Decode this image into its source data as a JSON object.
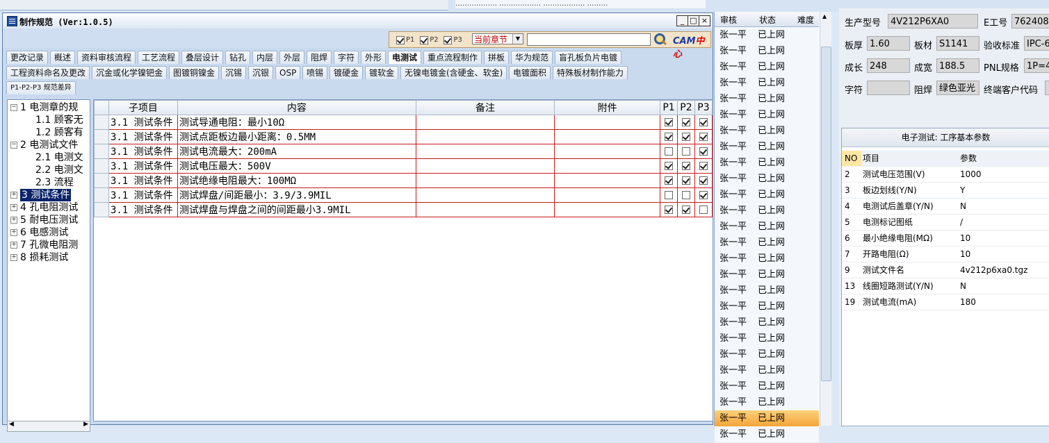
{
  "top_strip": {
    "partial_text": "……………… ……………… ……………… ………"
  },
  "window": {
    "title": "制作规范 (Ver:1.0.5)",
    "buttons": {
      "minimize": "_",
      "maximize": "□",
      "close": "×"
    }
  },
  "toolbar": {
    "p1": "P1",
    "p2": "P2",
    "p3": "P3",
    "chapter_select": "当前章节",
    "search_placeholder": "",
    "logo_main": "CAM",
    "logo_accent": "中心"
  },
  "tabs_row1": [
    "更改记录",
    "概述",
    "资料审核流程",
    "工艺流程",
    "叠层设计",
    "钻孔",
    "内层",
    "外层",
    "阻焊",
    "字符",
    "外形",
    "电测试",
    "重点流程制作",
    "拼板",
    "华为规范",
    "盲孔板负片电镀"
  ],
  "tabs_row2": [
    "工程资料命名及更改",
    "沉金或化学镍钯金",
    "图镀铜镍金",
    "沉锡",
    "沉银",
    "OSP",
    "喷锡",
    "镀硬金",
    "镀软金",
    "无镍电镀金(含硬金、软金)",
    "电镀面积",
    "特殊板材制作能力"
  ],
  "tabs_row3": [
    "P1-P2-P3 规范差异"
  ],
  "active_tab": "电测试",
  "tree": [
    {
      "label": "1 电测章的规",
      "level": 0,
      "exp": "−"
    },
    {
      "label": "1.1 顾客无",
      "level": 1
    },
    {
      "label": "1.2 顾客有",
      "level": 1
    },
    {
      "label": "2 电测试文件",
      "level": 0,
      "exp": "−"
    },
    {
      "label": "2.1 电测文",
      "level": 1
    },
    {
      "label": "2.2 电测文",
      "level": 1
    },
    {
      "label": "2.3 流程",
      "level": 1
    },
    {
      "label": "3 测试条件",
      "level": 0,
      "exp": "+",
      "selected": true
    },
    {
      "label": "4 孔电阻测试",
      "level": 0,
      "exp": "+"
    },
    {
      "label": "5 耐电压测试",
      "level": 0,
      "exp": "+"
    },
    {
      "label": "6 电感测试",
      "level": 0,
      "exp": "+"
    },
    {
      "label": "7 孔微电阻测",
      "level": 0,
      "exp": "+"
    },
    {
      "label": "8 损耗测试",
      "level": 0,
      "exp": "+"
    }
  ],
  "grid": {
    "headers": [
      "子项目",
      "内容",
      "备注",
      "附件",
      "P1",
      "P2",
      "P3"
    ],
    "rows": [
      {
        "sub": "3.1 测试条件",
        "content": "测试导通电阻：最小10Ω",
        "note": "",
        "att": "",
        "p1": true,
        "p2": true,
        "p3": true
      },
      {
        "sub": "3.1 测试条件",
        "content": "测试点距板边最小距离：0.5MM",
        "note": "",
        "att": "",
        "p1": true,
        "p2": true,
        "p3": true
      },
      {
        "sub": "3.1 测试条件",
        "content": "测试电流最大：200mA",
        "note": "",
        "att": "",
        "p1": false,
        "p2": false,
        "p3": true
      },
      {
        "sub": "3.1 测试条件",
        "content": "测试电压最大：500V",
        "note": "",
        "att": "",
        "p1": true,
        "p2": true,
        "p3": true
      },
      {
        "sub": "3.1 测试条件",
        "content": "测试绝缘电阻最大：100MΩ",
        "note": "",
        "att": "",
        "p1": true,
        "p2": true,
        "p3": true
      },
      {
        "sub": "3.1 测试条件",
        "content": "测试焊盘/间距最小：3.9/3.9MIL",
        "note": "",
        "att": "",
        "p1": false,
        "p2": false,
        "p3": true
      },
      {
        "sub": "3.1 测试条件",
        "content": "测试焊盘与焊盘之间的间距最小3.9MIL",
        "note": "",
        "att": "",
        "p1": true,
        "p2": true,
        "p3": false
      }
    ]
  },
  "review": {
    "headers": [
      "审核",
      "状态",
      "难度"
    ],
    "rows": [
      {
        "reviewer": "张一平",
        "status": "已上网"
      },
      {
        "reviewer": "张一平",
        "status": "已上网"
      },
      {
        "reviewer": "张一平",
        "status": "已上网"
      },
      {
        "reviewer": "张一平",
        "status": "已上网"
      },
      {
        "reviewer": "张一平",
        "status": "已上网"
      },
      {
        "reviewer": "张一平",
        "status": "已上网"
      },
      {
        "reviewer": "张一平",
        "status": "已上网"
      },
      {
        "reviewer": "张一平",
        "status": "已上网"
      },
      {
        "reviewer": "张一平",
        "status": "已上网"
      },
      {
        "reviewer": "张一平",
        "status": "已上网"
      },
      {
        "reviewer": "张一平",
        "status": "已上网"
      },
      {
        "reviewer": "张一平",
        "status": "已上网"
      },
      {
        "reviewer": "张一平",
        "status": "已上网"
      },
      {
        "reviewer": "张一平",
        "status": "已上网"
      },
      {
        "reviewer": "张一平",
        "status": "已上网"
      },
      {
        "reviewer": "张一平",
        "status": "已上网"
      },
      {
        "reviewer": "张一平",
        "status": "已上网"
      },
      {
        "reviewer": "张一平",
        "status": "已上网"
      },
      {
        "reviewer": "张一平",
        "status": "已上网"
      },
      {
        "reviewer": "张一平",
        "status": "已上网"
      },
      {
        "reviewer": "张一平",
        "status": "已上网"
      },
      {
        "reviewer": "张一平",
        "status": "已上网"
      },
      {
        "reviewer": "张一平",
        "status": "已上网"
      },
      {
        "reviewer": "张一平",
        "status": "已上网"
      },
      {
        "reviewer": "张一平",
        "status": "已上网"
      },
      {
        "reviewer": "张一平",
        "status": "已上网"
      }
    ],
    "highlight_color": "#f4a43a"
  },
  "info": {
    "model_label": "生产型号",
    "model": "4V212P6XA0",
    "e_label": "E工号",
    "e_no": "762408",
    "thick_label": "板厚",
    "thick": "1.60",
    "mat_label": "板材",
    "mat": "S1141",
    "std_label": "验收标准",
    "std": "IPC-6",
    "len_label": "成长",
    "len": "248",
    "wid_label": "成宽",
    "wid": "188.5",
    "pnl_label": "PNL规格",
    "pnl": "1P=4",
    "char_label": "字符",
    "char": "",
    "mask_label": "阻焊",
    "mask": "绿色亚光",
    "cust_label": "终端客户代码",
    "cust": ""
  },
  "params": {
    "title": "电子测试: 工序基本参数",
    "headers": {
      "no": "NO",
      "item": "项目",
      "param": "参数"
    },
    "rows": [
      {
        "no": "2",
        "item": "测试电压范围(V)",
        "param": "1000"
      },
      {
        "no": "3",
        "item": "板边划线(Y/N)",
        "param": "Y"
      },
      {
        "no": "4",
        "item": "电测试后盖章(Y/N)",
        "param": "N"
      },
      {
        "no": "5",
        "item": "电测标记图纸",
        "param": "/"
      },
      {
        "no": "6",
        "item": "最小绝缘电阻(MΩ)",
        "param": "10"
      },
      {
        "no": "7",
        "item": "开路电阻(Ω)",
        "param": "10"
      },
      {
        "no": "9",
        "item": "测试文件名",
        "param": "4v212p6xa0.tgz"
      },
      {
        "no": "13",
        "item": "线圈短路测试(Y/N)",
        "param": "N"
      },
      {
        "no": "19",
        "item": "测试电流(mA)",
        "param": "180"
      }
    ]
  }
}
